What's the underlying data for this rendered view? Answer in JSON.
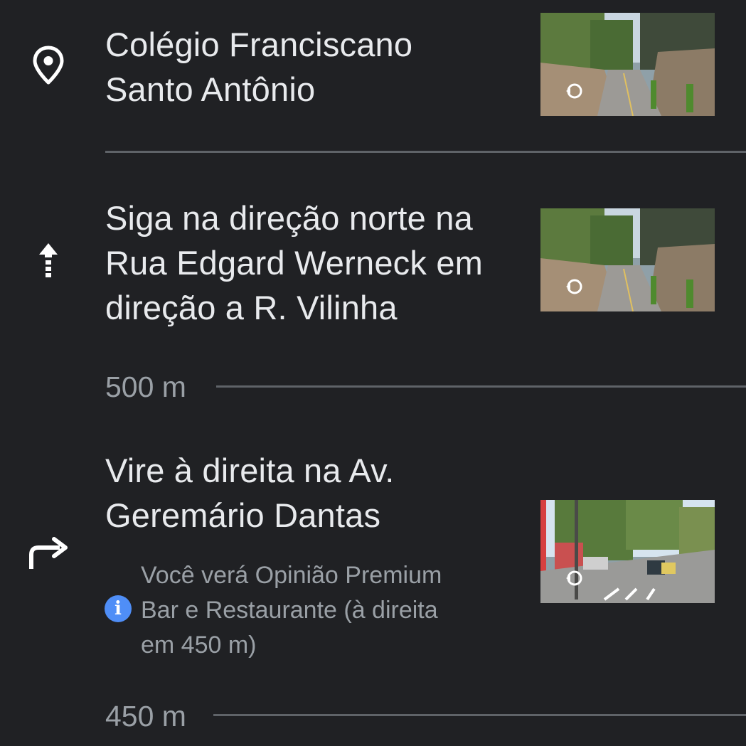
{
  "steps": [
    {
      "icon": "location-pin-icon",
      "text_lines": [
        "Colégio Franciscano",
        "Santo Antônio"
      ],
      "thumbnail": "street-view-thumbnail"
    },
    {
      "icon": "straight-arrow-icon",
      "text_lines": [
        "Siga na direção norte na",
        "Rua Edgard Werneck em",
        "direção a R. Vilinha"
      ],
      "thumbnail": "street-view-thumbnail",
      "distance": "500 m"
    },
    {
      "icon": "turn-right-icon",
      "text_lines": [
        "Vire à direita na Av.",
        "Geremário Dantas"
      ],
      "hint": {
        "icon": "info-icon",
        "lines": [
          "Você verá Opinião Premium",
          "Bar e Restaurante (à direita",
          "em 450 m)"
        ]
      },
      "thumbnail": "street-view-thumbnail",
      "distance": "450 m"
    }
  ],
  "colors": {
    "background": "#202124",
    "primary_text": "#e8eaed",
    "secondary_text": "#9aa0a6",
    "divider": "#5f6368",
    "info_accent": "#4f8ef7"
  }
}
